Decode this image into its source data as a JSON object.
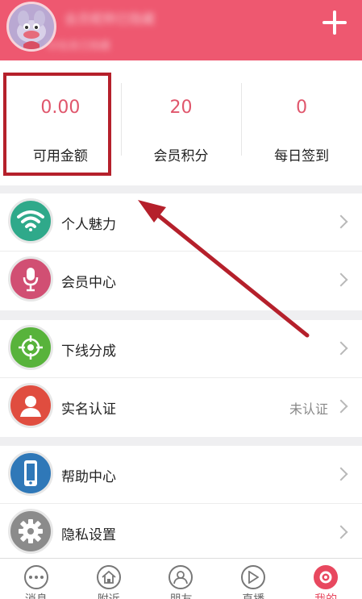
{
  "header": {
    "username": "会员昵称已隐藏",
    "subtitle": "ID信息已隐藏"
  },
  "stats": [
    {
      "value": "0.00",
      "label": "可用金额"
    },
    {
      "value": "20",
      "label": "会员积分"
    },
    {
      "value": "0",
      "label": "每日签到"
    }
  ],
  "menu_groups": [
    [
      {
        "label": "个人魅力",
        "icon": "wifi-icon",
        "color": "#2fa98a"
      },
      {
        "label": "会员中心",
        "icon": "microphone-icon",
        "color": "#d14f73"
      }
    ],
    [
      {
        "label": "下线分成",
        "icon": "target-icon",
        "color": "#58b33b"
      },
      {
        "label": "实名认证",
        "icon": "user-icon",
        "color": "#e04d3f",
        "value": "未认证"
      }
    ],
    [
      {
        "label": "帮助中心",
        "icon": "phone-icon",
        "color": "#2f78b8"
      },
      {
        "label": "隐私设置",
        "icon": "gear-icon",
        "color": "#8b8b8b"
      }
    ]
  ],
  "tabs": [
    {
      "label": "消息",
      "icon": "chat-icon"
    },
    {
      "label": "附近",
      "icon": "home-icon"
    },
    {
      "label": "朋友",
      "icon": "person-icon"
    },
    {
      "label": "直播",
      "icon": "play-icon"
    },
    {
      "label": "我的",
      "icon": "settings-icon",
      "active": true
    }
  ],
  "colors": {
    "accent": "#ee5870",
    "value_red": "#e0566c",
    "annotation_red": "#b5202b"
  }
}
